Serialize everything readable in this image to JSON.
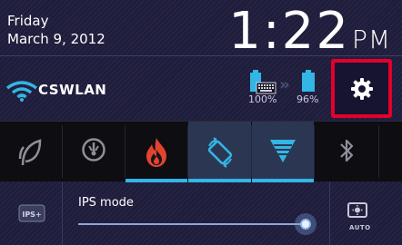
{
  "header": {
    "weekday": "Friday",
    "date": "March 9, 2012",
    "time": "1:22",
    "ampm": "PM"
  },
  "wifi": {
    "ssid": "CSWLAN"
  },
  "battery": {
    "tablet_percent": "100%",
    "keyboard_percent": "96%"
  },
  "toggles": [
    {
      "name": "eco-mode",
      "icon": "leaf-icon",
      "active": false
    },
    {
      "name": "cpu-mode",
      "icon": "gauge-icon",
      "active": false
    },
    {
      "name": "performance-mode",
      "icon": "flame-icon",
      "active": true
    },
    {
      "name": "auto-rotate",
      "icon": "rotate-icon",
      "active": true
    },
    {
      "name": "signal",
      "icon": "signal-triangle-icon",
      "active": true
    },
    {
      "name": "bluetooth",
      "icon": "bluetooth-icon",
      "active": false
    }
  ],
  "ips": {
    "label": "IPS mode",
    "badge": "IPS+",
    "level": 1.0
  },
  "auto_brightness": {
    "label": "AUTO"
  },
  "colors": {
    "accent_blue": "#33b5e5",
    "highlight_red": "#e4002a",
    "flame_red": "#e0442e"
  }
}
